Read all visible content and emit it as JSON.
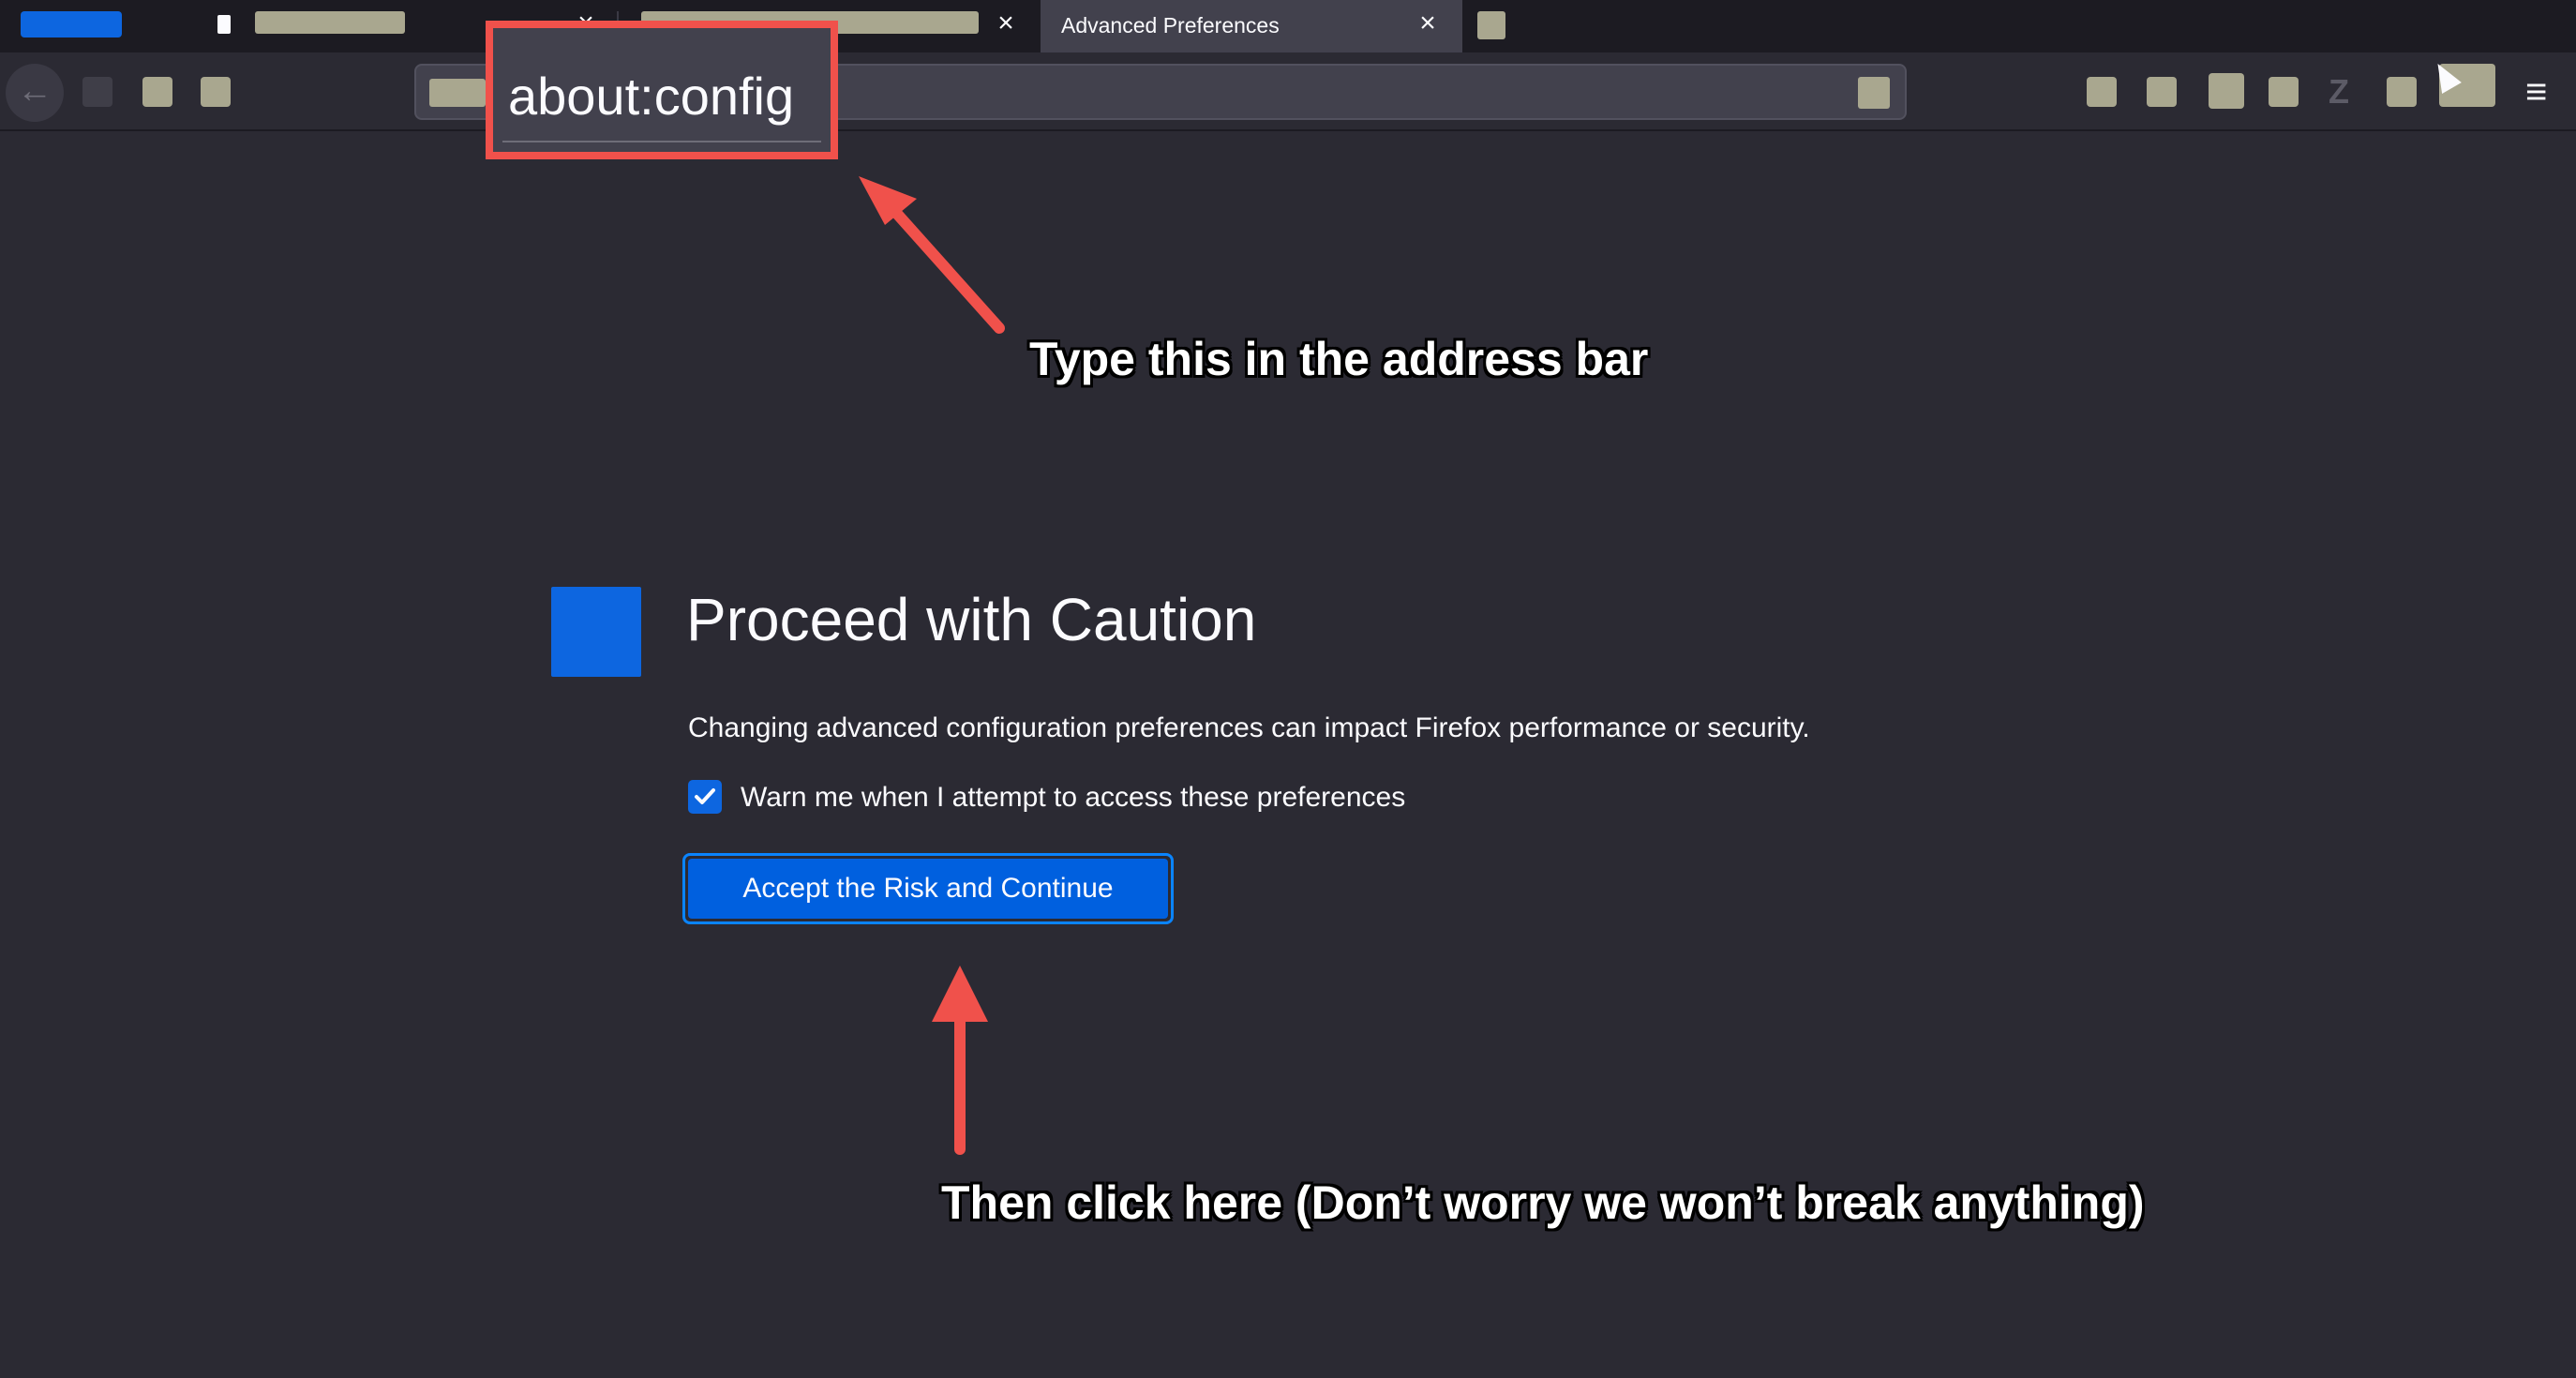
{
  "tabs": {
    "active_title": "Advanced Preferences"
  },
  "address_bar": {
    "value": "about:config"
  },
  "annotations": {
    "address_hint": "Type this in the address bar",
    "button_hint": "Then click here (Don’t worry we won’t break anything)",
    "highlight_color": "#f0514b"
  },
  "page": {
    "heading": "Proceed with Caution",
    "description": "Changing advanced configuration preferences can impact Firefox performance or security.",
    "checkbox_label": "Warn me when I attempt to access these preferences",
    "checkbox_checked": true,
    "accept_button": "Accept the Risk and Continue"
  },
  "colors": {
    "background": "#2b2a33",
    "accent": "#0060df"
  }
}
